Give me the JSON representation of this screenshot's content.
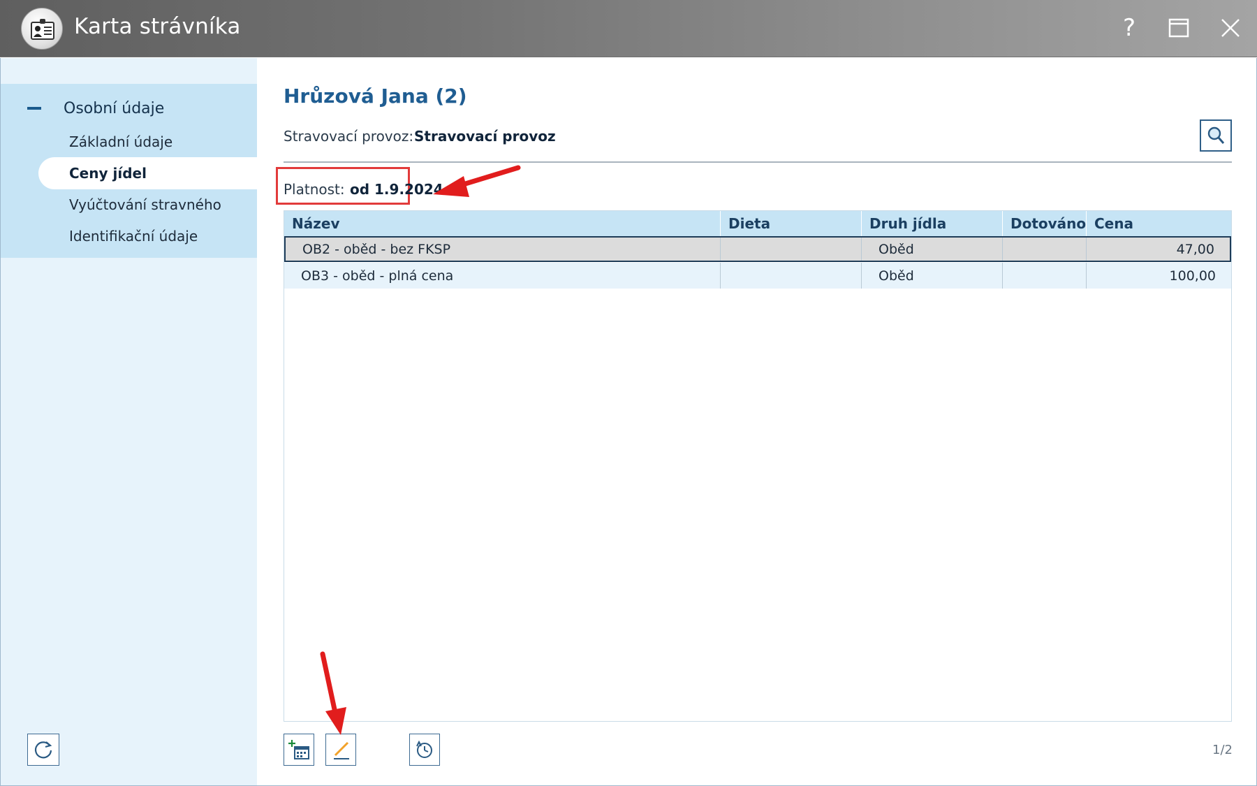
{
  "window": {
    "title": "Karta strávníka",
    "help_label": "?"
  },
  "sidebar": {
    "group_label": "Osobní údaje",
    "items": [
      {
        "label": "Základní údaje",
        "active": false
      },
      {
        "label": "Ceny jídel",
        "active": true
      },
      {
        "label": "Vyúčtování stravného",
        "active": false
      },
      {
        "label": "Identifikační údaje",
        "active": false
      }
    ]
  },
  "main": {
    "title": "Hrůzová Jana (2)",
    "provoz_label": "Stravovací provoz:",
    "provoz_value": "Stravovací provoz",
    "platnost_label": "Platnost:",
    "platnost_value": "od 1.9.2024",
    "table": {
      "columns": [
        "Název",
        "Dieta",
        "Druh jídla",
        "Dotováno",
        "Cena"
      ],
      "rows": [
        {
          "nazev": "OB2 - oběd - bez FKSP",
          "dieta": "",
          "druh": "Oběd",
          "dotovano": "",
          "cena": "47,00",
          "selected": true
        },
        {
          "nazev": "OB3 - oběd - plná cena",
          "dieta": "",
          "druh": "Oběd",
          "dotovano": "",
          "cena": "100,00",
          "selected": false
        }
      ]
    },
    "pager": "1/2"
  },
  "colors": {
    "accent": "#1f5d92",
    "sidebar_bg": "#e7f3fb",
    "group_bg": "#c6e4f5",
    "annotation": "#e11d1d"
  },
  "icons": {
    "app": "user-card-icon",
    "help": "help-icon",
    "maximize": "maximize-icon",
    "close": "close-icon",
    "search": "magnifier-icon",
    "refresh": "refresh-icon",
    "add": "add-calendar-icon",
    "edit": "pencil-icon",
    "history": "history-icon"
  }
}
